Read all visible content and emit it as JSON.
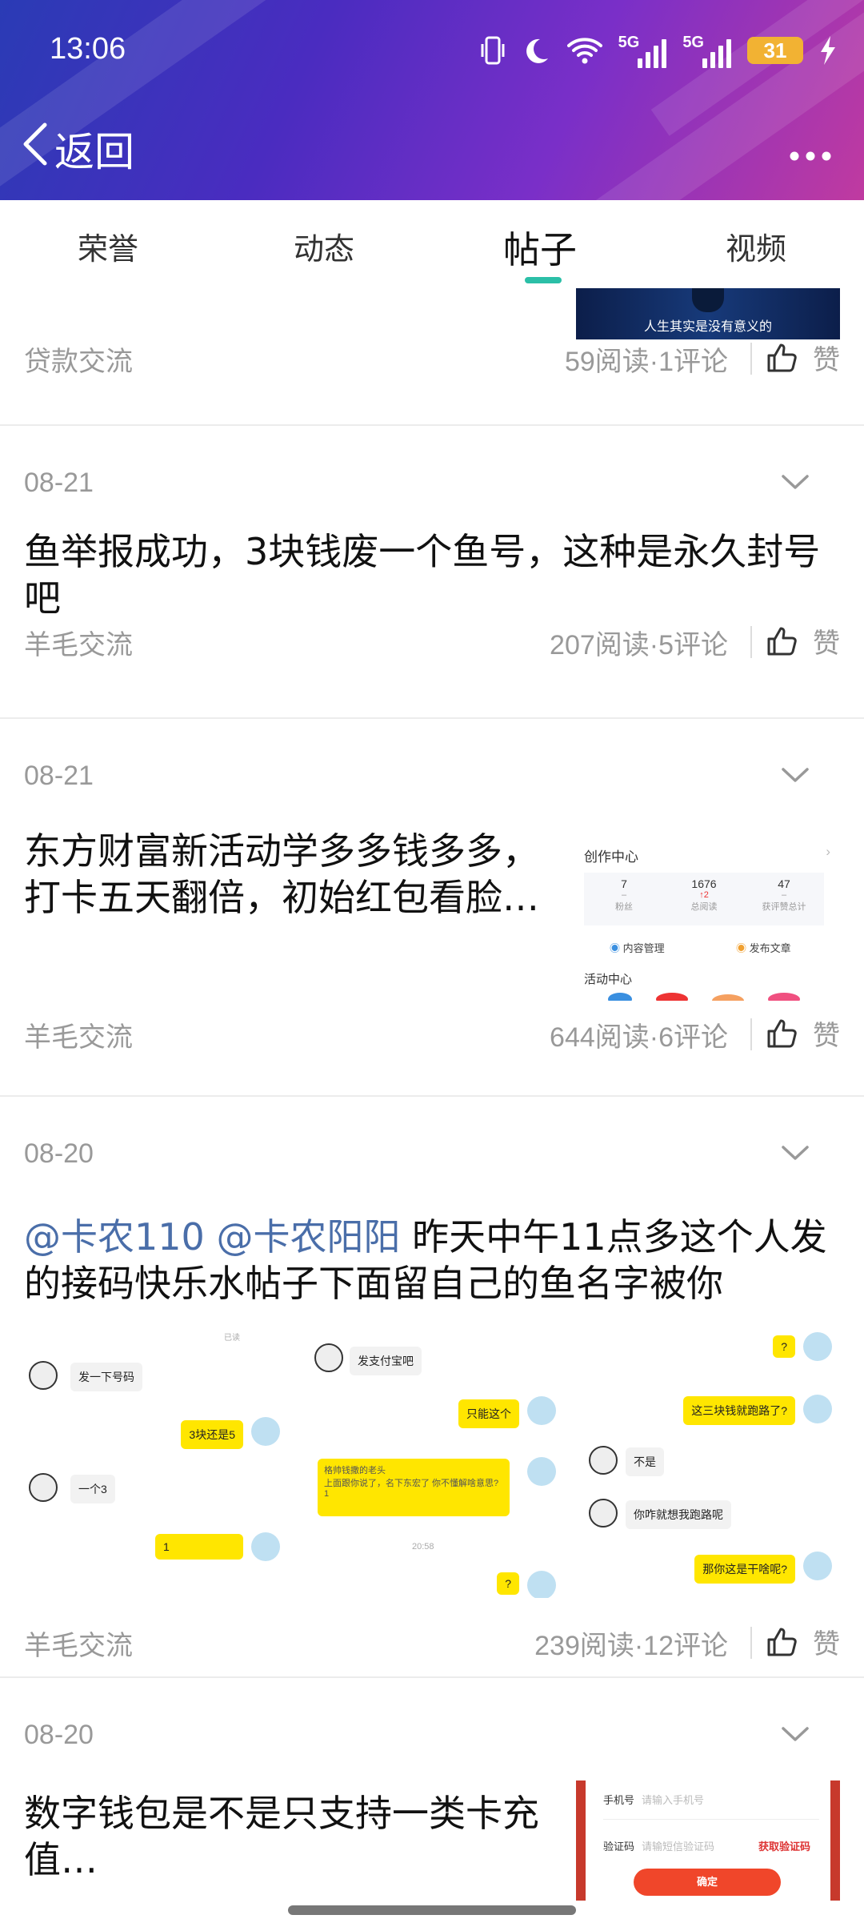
{
  "status_bar": {
    "time": "13:06",
    "battery": "31",
    "net1_label": "5G",
    "net2_label": "5G"
  },
  "header": {
    "back_label": "返回"
  },
  "tabs": [
    {
      "label": "荣誉",
      "active": false
    },
    {
      "label": "动态",
      "active": false
    },
    {
      "label": "帖子",
      "active": true
    },
    {
      "label": "视频",
      "active": false
    }
  ],
  "first_card": {
    "thumb_caption": "人生其实是没有意义的",
    "category": "贷款交流",
    "stats": "59阅读·1评论",
    "like_label": "赞"
  },
  "posts": [
    {
      "date": "08-21",
      "title": "鱼举报成功，3块钱废一个鱼号，这种是永久封号吧",
      "category": "羊毛交流",
      "stats": "207阅读·5评论",
      "like_label": "赞"
    },
    {
      "date": "08-21",
      "title": "东方财富新活动学多多钱多多，打卡五天翻倍，初始红包看脸…",
      "category": "羊毛交流",
      "stats": "644阅读·6评论",
      "like_label": "赞",
      "thumb": {
        "heading": "创作中心",
        "stats": [
          {
            "value": "7",
            "sub": "–",
            "label": "粉丝"
          },
          {
            "value": "1676",
            "sub": "↑2",
            "label": "总阅读"
          },
          {
            "value": "47",
            "sub": "–",
            "label": "获评赞总计"
          }
        ],
        "link1": "内容管理",
        "link2": "发布文章",
        "activity": "活动中心"
      }
    },
    {
      "date": "08-20",
      "mention1": "@卡农110",
      "mention2": "@卡农阳阳",
      "title": "昨天中午11点多这个人发的接码快乐水帖子下面留自己的鱼名字被你",
      "category": "羊毛交流",
      "stats": "239阅读·12评论",
      "like_label": "赞",
      "chat": {
        "c1": [
          "发一下号码",
          "3块还是5",
          "一个3",
          "1"
        ],
        "c2": [
          "发支付宝吧",
          "只能这个",
          "格帅钱撒的老头\n上面跟你说了，名下东宏了 你不懂解啥意思?\n1",
          "20:58",
          "?"
        ],
        "c3": [
          "?",
          "这三块钱就跑路了?",
          "不是",
          "你咋就想我跑路呢",
          "那你这是干啥呢?"
        ],
        "read": "已读"
      }
    },
    {
      "date": "08-20",
      "title": "数字钱包是不是只支持一类卡充值…",
      "thumb": {
        "phone_label": "手机号",
        "phone_placeholder": "请输入手机号",
        "code_label": "验证码",
        "code_placeholder": "请输短信验证码",
        "get_code": "获取验证码",
        "confirm": "确定"
      }
    }
  ],
  "colors": {
    "accent": "#2bbfa7",
    "mention": "#4a6ea9",
    "chat_bubble": "#ffe600"
  }
}
